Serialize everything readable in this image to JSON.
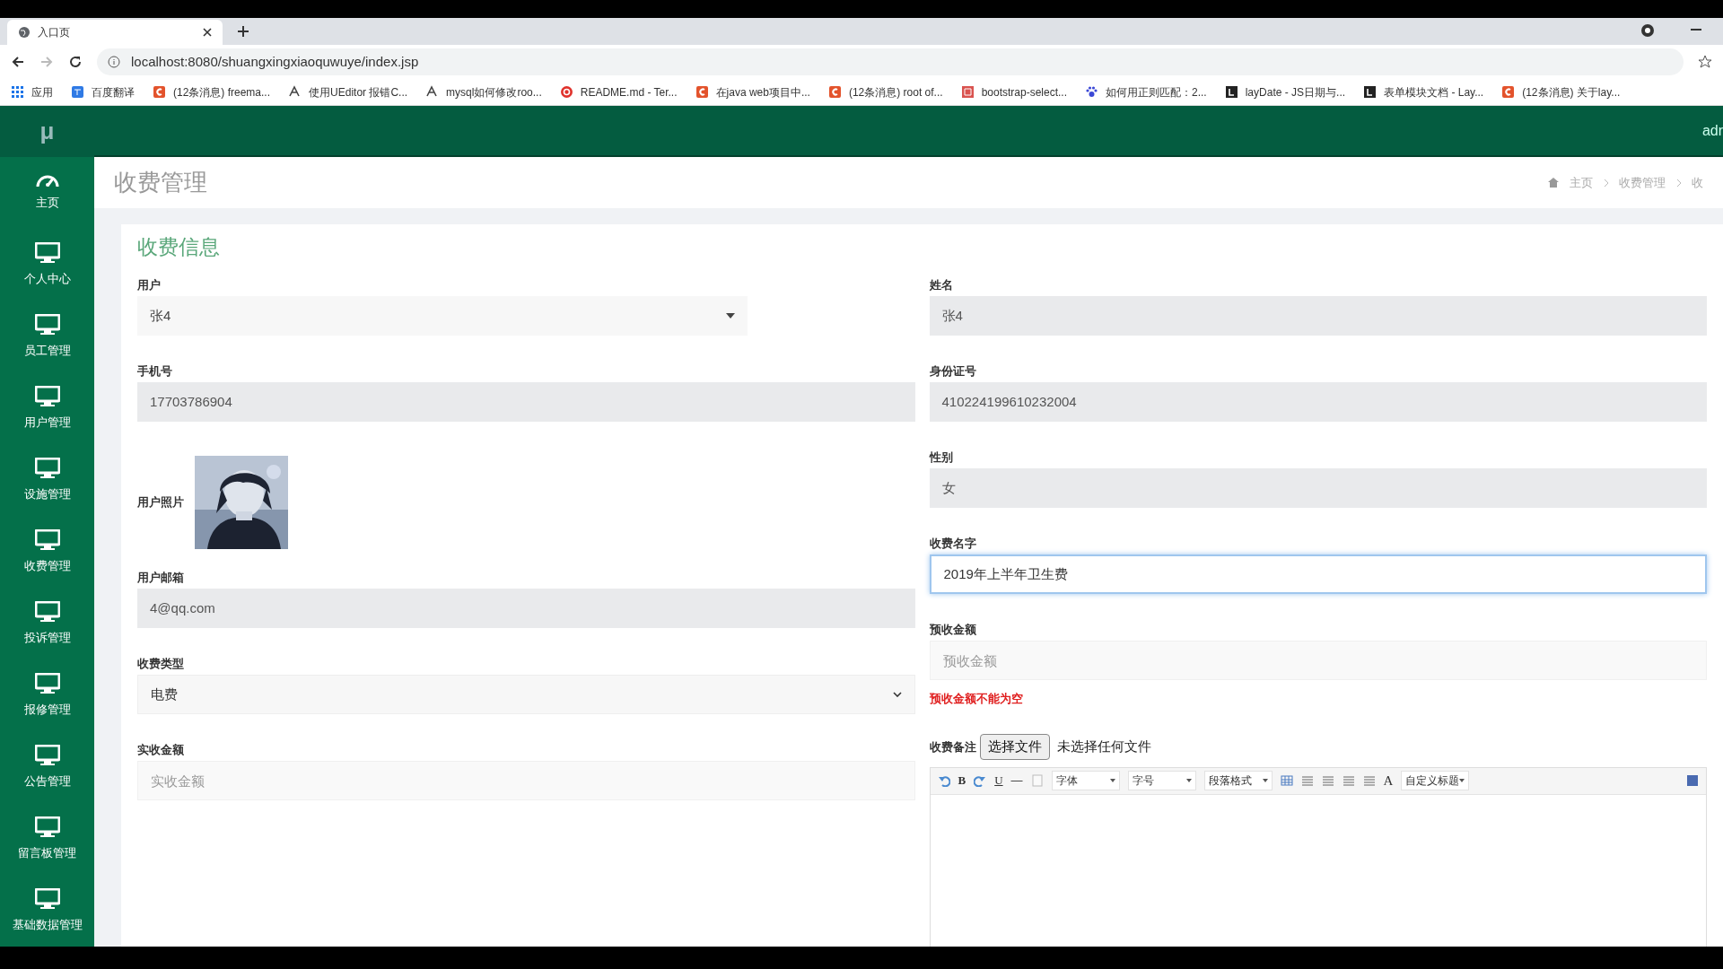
{
  "browser": {
    "tab": {
      "title": "入口页"
    },
    "url": "localhost:8080/shuangxingxiaoquwuye/index.jsp",
    "bookmarks": [
      {
        "kind": "apps",
        "label": "应用"
      },
      {
        "kind": "translate",
        "label": "百度翻译"
      },
      {
        "kind": "csdn",
        "label": "(12条消息) freema..."
      },
      {
        "kind": "ueditor",
        "label": "使用UEditor 报错C..."
      },
      {
        "kind": "ueditor",
        "label": "mysql如何修改roo..."
      },
      {
        "kind": "readme",
        "label": "README.md - Ter..."
      },
      {
        "kind": "csdn",
        "label": "在java web项目中..."
      },
      {
        "kind": "csdn",
        "label": "(12条消息) root of..."
      },
      {
        "kind": "bootstrap",
        "label": "bootstrap-select..."
      },
      {
        "kind": "paw",
        "label": "如何用正则匹配：2..."
      },
      {
        "kind": "layui",
        "label": "layDate - JS日期与..."
      },
      {
        "kind": "layui",
        "label": "表单模块文档 - Lay..."
      },
      {
        "kind": "csdn",
        "label": "(12条消息) 关于lay..."
      }
    ]
  },
  "header": {
    "logo": "μ",
    "user": "adr"
  },
  "sidebar": {
    "items": [
      {
        "kind": "dashboard",
        "label": "主页",
        "selected": false
      },
      {
        "kind": "monitor",
        "label": "个人中心",
        "selected": false
      },
      {
        "kind": "monitor",
        "label": "员工管理",
        "selected": false
      },
      {
        "kind": "monitor",
        "label": "用户管理",
        "selected": false
      },
      {
        "kind": "monitor",
        "label": "设施管理",
        "selected": false
      },
      {
        "kind": "monitor",
        "label": "收费管理",
        "selected": false
      },
      {
        "kind": "monitor",
        "label": "投诉管理",
        "selected": false
      },
      {
        "kind": "monitor",
        "label": "报修管理",
        "selected": false
      },
      {
        "kind": "monitor",
        "label": "公告管理",
        "selected": false
      },
      {
        "kind": "monitor",
        "label": "留言板管理",
        "selected": false
      },
      {
        "kind": "monitor",
        "label": "基础数据管理",
        "selected": false
      }
    ]
  },
  "page": {
    "title": "收费管理",
    "breadcrumb": [
      "主页",
      "收费管理",
      "收"
    ]
  },
  "form": {
    "title": "收费信息",
    "left": [
      {
        "kind": "select",
        "label": "用户",
        "value": "张4"
      },
      {
        "kind": "readonly",
        "label": "手机号",
        "value": "17703786904"
      },
      {
        "label": "用户照片"
      },
      {
        "kind": "readonly",
        "label": "用户邮箱",
        "value": "4@qq.com"
      },
      {
        "kind": "native-select",
        "label": "收费类型",
        "value": "电费"
      },
      {
        "kind": "input",
        "label": "实收金额",
        "placeholder": "实收金额"
      }
    ],
    "right": [
      {
        "kind": "readonly",
        "label": "姓名",
        "value": "张4"
      },
      {
        "kind": "readonly",
        "label": "身份证号",
        "value": "410224199610232004"
      },
      {
        "kind": "readonly",
        "label": "性别",
        "value": "女"
      },
      {
        "kind": "focused",
        "label": "收费名字",
        "value": "2019年上半年卫生费"
      },
      {
        "kind": "input",
        "label": "预收金额",
        "placeholder": "预收金额",
        "error": "预收金额不能为空"
      }
    ],
    "remark": {
      "label": "收费备注",
      "file_button": "选择文件",
      "file_status": "未选择任何文件",
      "toolbar": [
        {
          "kind": "undo"
        },
        {
          "kind": "letter",
          "text": "B"
        },
        {
          "kind": "redo"
        },
        {
          "kind": "underline",
          "text": "U"
        },
        {
          "kind": "rule",
          "text": "—"
        },
        {
          "kind": "page"
        },
        {
          "kind": "dropdown",
          "text": "字体"
        },
        {
          "kind": "dropdown",
          "text": "字号"
        },
        {
          "kind": "dropdown",
          "text": "段落格式"
        },
        {
          "kind": "table"
        },
        {
          "kind": "align"
        },
        {
          "kind": "align"
        },
        {
          "kind": "align"
        },
        {
          "kind": "align"
        },
        {
          "kind": "color",
          "text": "A"
        },
        {
          "kind": "dropdown",
          "text": "自定义标题"
        }
      ]
    }
  }
}
